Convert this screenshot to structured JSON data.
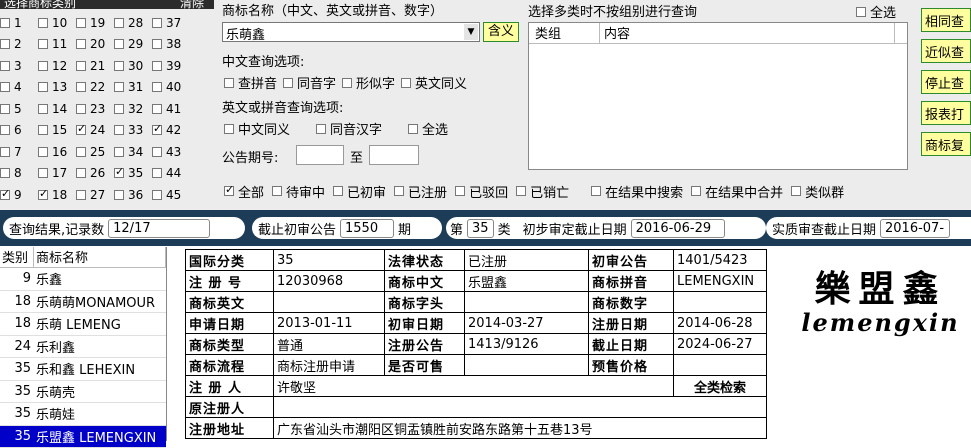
{
  "class_panel": {
    "header": "选择商标类别",
    "clear": "清除",
    "rows": [
      [
        {
          "n": "1",
          "c": false
        },
        {
          "n": "10",
          "c": false
        },
        {
          "n": "19",
          "c": false
        },
        {
          "n": "28",
          "c": false
        },
        {
          "n": "37",
          "c": false
        }
      ],
      [
        {
          "n": "2",
          "c": false
        },
        {
          "n": "11",
          "c": false
        },
        {
          "n": "20",
          "c": false
        },
        {
          "n": "29",
          "c": false
        },
        {
          "n": "38",
          "c": false
        }
      ],
      [
        {
          "n": "3",
          "c": false
        },
        {
          "n": "12",
          "c": false
        },
        {
          "n": "21",
          "c": false
        },
        {
          "n": "30",
          "c": false
        },
        {
          "n": "39",
          "c": false
        }
      ],
      [
        {
          "n": "4",
          "c": false
        },
        {
          "n": "13",
          "c": false
        },
        {
          "n": "22",
          "c": false
        },
        {
          "n": "31",
          "c": false
        },
        {
          "n": "40",
          "c": false
        }
      ],
      [
        {
          "n": "5",
          "c": false
        },
        {
          "n": "14",
          "c": false
        },
        {
          "n": "23",
          "c": false
        },
        {
          "n": "32",
          "c": false
        },
        {
          "n": "41",
          "c": false
        }
      ],
      [
        {
          "n": "6",
          "c": false
        },
        {
          "n": "15",
          "c": false
        },
        {
          "n": "24",
          "c": true
        },
        {
          "n": "33",
          "c": false
        },
        {
          "n": "42",
          "c": true
        }
      ],
      [
        {
          "n": "7",
          "c": false
        },
        {
          "n": "16",
          "c": false
        },
        {
          "n": "25",
          "c": false
        },
        {
          "n": "34",
          "c": false
        },
        {
          "n": "43",
          "c": false
        }
      ],
      [
        {
          "n": "8",
          "c": false
        },
        {
          "n": "17",
          "c": false
        },
        {
          "n": "26",
          "c": false
        },
        {
          "n": "35",
          "c": true
        },
        {
          "n": "44",
          "c": false
        }
      ],
      [
        {
          "n": "9",
          "c": true
        },
        {
          "n": "18",
          "c": true
        },
        {
          "n": "27",
          "c": false
        },
        {
          "n": "36",
          "c": false
        },
        {
          "n": "45",
          "c": false
        }
      ]
    ]
  },
  "search": {
    "name_label": "商标名称（中文、英文或拼音、数字）",
    "name_value": "乐萌鑫",
    "meaning_btn": "含义",
    "cn_options_label": "中文查询选项:",
    "cn_options": [
      "查拼音",
      "同音字",
      "形似字",
      "英文同义"
    ],
    "en_options_label": "英文或拼音查询选项:",
    "en_options": [
      "中文同义",
      "同音汉字",
      "全选"
    ],
    "period_label": "公告期号:",
    "period_to": "至"
  },
  "multi_class": {
    "label": "选择多类时不按组别进行查询",
    "select_all": "全选",
    "col1": "类组",
    "col2": "内容"
  },
  "right_buttons": [
    "相同查",
    "近似查",
    "停止查",
    "报表打",
    "商标复"
  ],
  "filters": [
    {
      "label": "全部",
      "c": true
    },
    {
      "label": "待审中",
      "c": false
    },
    {
      "label": "已初审",
      "c": false
    },
    {
      "label": "已注册",
      "c": false
    },
    {
      "label": "已驳回",
      "c": false
    },
    {
      "label": "已销亡",
      "c": false
    },
    {
      "label": "在结果中搜索",
      "c": false
    },
    {
      "label": "在结果中合并",
      "c": false
    },
    {
      "label": "类似群",
      "c": false
    }
  ],
  "status": {
    "result_label": "查询结果,记录数",
    "result_value": "12/17",
    "cutoff_label": "截止初审公告",
    "cutoff_value": "1550",
    "cutoff_unit": "期",
    "class_prefix": "第",
    "class_value": "35",
    "class_suffix": "类",
    "prelim_label": "初步审定截止日期",
    "prelim_value": "2016-06-29",
    "exam_label": "实质审查截止日期",
    "exam_value": "2016-07-"
  },
  "list": {
    "col1": "类别",
    "col2": "商标名称",
    "rows": [
      {
        "cls": "9",
        "name": "乐鑫"
      },
      {
        "cls": "18",
        "name": "乐萌萌MONAMOUR"
      },
      {
        "cls": "18",
        "name": "乐萌 LEMENG"
      },
      {
        "cls": "24",
        "name": "乐利鑫"
      },
      {
        "cls": "35",
        "name": "乐和鑫 LEHEXIN"
      },
      {
        "cls": "35",
        "name": "乐萌壳"
      },
      {
        "cls": "35",
        "name": "乐萌娃"
      },
      {
        "cls": "35",
        "name": "乐盟鑫 LEMENGXIN",
        "selected": true
      }
    ]
  },
  "detail": {
    "intl_class_k": "国际分类",
    "intl_class_v": "35",
    "legal_k": "法律状态",
    "legal_v": "已注册",
    "prelim_k": "初审公告",
    "prelim_v": "1401/5423",
    "regno_k": "注 册 号",
    "regno_v": "12030968",
    "cn_k": "商标中文",
    "cn_v": "乐盟鑫",
    "py_k": "商标拼音",
    "py_v": "LEMENGXIN",
    "en_k": "商标英文",
    "en_v": "",
    "head_k": "商标字头",
    "head_v": "",
    "num_k": "商标数字",
    "num_v": "",
    "apply_k": "申请日期",
    "apply_v": "2013-01-11",
    "prelimdate_k": "初审日期",
    "prelimdate_v": "2014-03-27",
    "regdate_k": "注册日期",
    "regdate_v": "2014-06-28",
    "type_k": "商标类型",
    "type_v": "普通",
    "regnotice_k": "注册公告",
    "regnotice_v": "1413/9126",
    "expire_k": "截止日期",
    "expire_v": "2024-06-27",
    "flow_k": "商标流程",
    "flow_v": "商标注册申请",
    "shared_k": "是否可售",
    "shared_v": "",
    "price_k": "预售价格",
    "price_v": "",
    "registrant_k": "注 册 人",
    "registrant_v": "许敬坚",
    "fullclass": "全类检索",
    "orig_k": "原注册人",
    "orig_v": "",
    "addr_k": "注册地址",
    "addr_v": "广东省汕头市潮阳区铜盂镇胜前安路东路第十五巷13号"
  },
  "logo": {
    "cn": "樂盟鑫",
    "en": "lemengxin"
  }
}
